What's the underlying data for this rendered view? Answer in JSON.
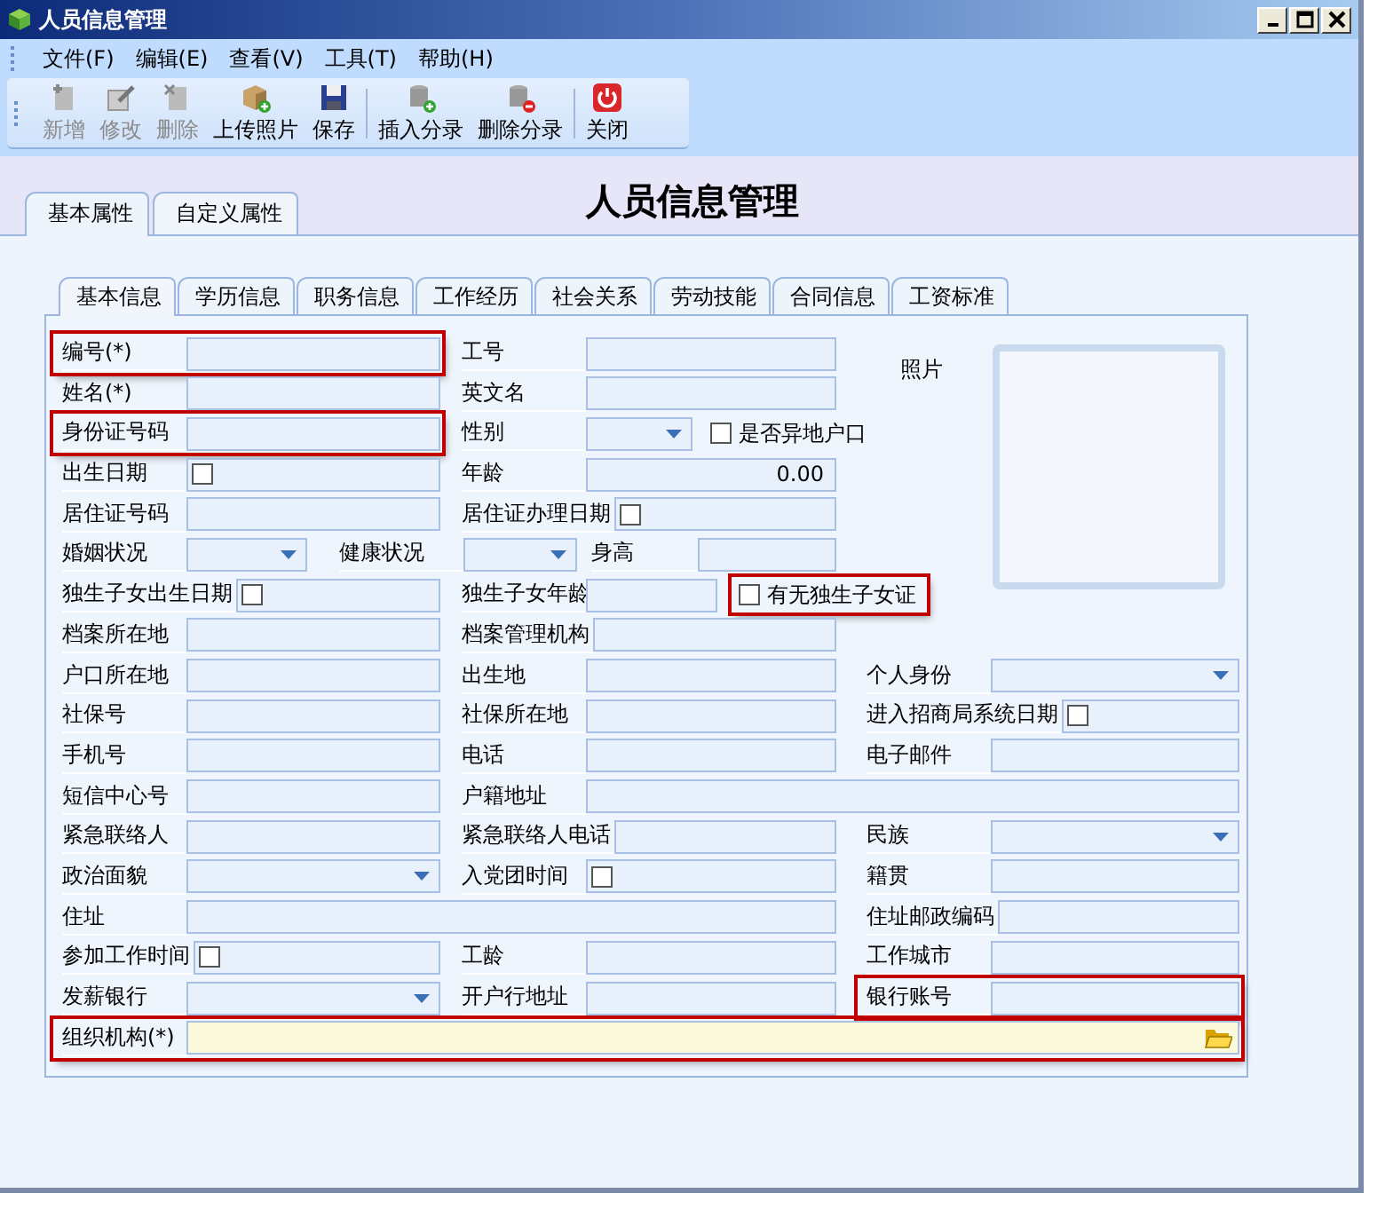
{
  "window": {
    "title": "人员信息管理"
  },
  "menu": [
    "文件(F)",
    "编辑(E)",
    "查看(V)",
    "工具(T)",
    "帮助(H)"
  ],
  "toolbar": [
    [
      {
        "label": "新增",
        "kind": "new",
        "disabled": true
      },
      {
        "label": "修改",
        "kind": "edit",
        "disabled": true
      },
      {
        "label": "删除",
        "kind": "delete",
        "disabled": true
      },
      {
        "label": "上传照片",
        "kind": "photo",
        "disabled": false
      },
      {
        "label": "保存",
        "kind": "save",
        "disabled": false
      }
    ],
    [
      {
        "label": "插入分录",
        "kind": "insert",
        "disabled": false
      },
      {
        "label": "删除分录",
        "kind": "remove",
        "disabled": false
      }
    ],
    [
      {
        "label": "关闭",
        "kind": "close",
        "disabled": false
      }
    ]
  ],
  "outer_tabs": [
    {
      "label": "基本属性",
      "selected": true
    },
    {
      "label": "自定义属性",
      "selected": false
    }
  ],
  "heading": "人员信息管理",
  "inner_tabs": [
    {
      "label": "基本信息",
      "selected": true
    },
    {
      "label": "学历信息",
      "selected": false
    },
    {
      "label": "职务信息",
      "selected": false
    },
    {
      "label": "工作经历",
      "selected": false
    },
    {
      "label": "社会关系",
      "selected": false
    },
    {
      "label": "劳动技能",
      "selected": false
    },
    {
      "label": "合同信息",
      "selected": false
    },
    {
      "label": "工资标准",
      "selected": false
    }
  ],
  "photo": {
    "label": "照片"
  },
  "form": {
    "rows": [
      {
        "kind": "std",
        "items": [
          {
            "label": "编号(*)",
            "kind": "text",
            "highlighted": true
          },
          {
            "label": "工号",
            "kind": "text"
          }
        ]
      },
      {
        "kind": "std",
        "items": [
          {
            "label": "姓名(*)",
            "kind": "text"
          },
          {
            "label": "英文名",
            "kind": "text"
          }
        ]
      },
      {
        "kind": "std",
        "items": [
          {
            "label": "身份证号码",
            "kind": "text",
            "highlighted": true
          },
          {
            "label": "性别",
            "kind": "combo",
            "check": {
              "label": "是否异地户口",
              "checked": false
            }
          }
        ]
      },
      {
        "kind": "std",
        "items": [
          {
            "label": "出生日期",
            "kind": "date",
            "checked": false
          },
          {
            "label": "年龄",
            "kind": "number",
            "value": "0.00"
          }
        ]
      },
      {
        "kind": "std",
        "items": [
          {
            "label": "居住证号码",
            "kind": "text"
          },
          {
            "label": "居住证办理日期",
            "kind": "date",
            "checked": false
          }
        ]
      },
      {
        "kind": "quad",
        "items": [
          {
            "label": "婚姻状况",
            "kind": "combo"
          },
          {
            "label": "健康状况",
            "kind": "combo"
          },
          {
            "label": "身高",
            "kind": "text"
          }
        ]
      },
      {
        "kind": "std",
        "items": [
          {
            "label": "独生子女出生日期",
            "kind": "date",
            "checked": false
          },
          {
            "label": "独生子女年龄",
            "kind": "text",
            "check": {
              "label": "有无独生子女证",
              "checked": false,
              "highlighted": true
            }
          }
        ]
      },
      {
        "kind": "std",
        "items": [
          {
            "label": "档案所在地",
            "kind": "text"
          },
          {
            "label": "档案管理机构",
            "kind": "text"
          }
        ]
      },
      {
        "kind": "std",
        "items": [
          {
            "label": "户口所在地",
            "kind": "text"
          },
          {
            "label": "出生地",
            "kind": "text"
          },
          {
            "label": "个人身份",
            "kind": "combo"
          }
        ]
      },
      {
        "kind": "std",
        "items": [
          {
            "label": "社保号",
            "kind": "text"
          },
          {
            "label": "社保所在地",
            "kind": "text"
          },
          {
            "label": "进入招商局系统日期",
            "kind": "date",
            "checked": false
          }
        ]
      },
      {
        "kind": "std",
        "items": [
          {
            "label": "手机号",
            "kind": "text"
          },
          {
            "label": "电话",
            "kind": "text"
          },
          {
            "label": "电子邮件",
            "kind": "text"
          }
        ]
      },
      {
        "kind": "wide-right",
        "items": [
          {
            "label": "短信中心号",
            "kind": "text"
          },
          {
            "label": "户籍地址",
            "kind": "text"
          }
        ]
      },
      {
        "kind": "std",
        "items": [
          {
            "label": "紧急联络人",
            "kind": "text"
          },
          {
            "label": "紧急联络人电话",
            "kind": "text"
          },
          {
            "label": "民族",
            "kind": "combo"
          }
        ]
      },
      {
        "kind": "std",
        "items": [
          {
            "label": "政治面貌",
            "kind": "combo"
          },
          {
            "label": "入党团时间",
            "kind": "date",
            "checked": false
          },
          {
            "label": "籍贯",
            "kind": "text"
          }
        ]
      },
      {
        "kind": "wide-left",
        "items": [
          {
            "label": "住址",
            "kind": "text"
          },
          {
            "label": "住址邮政编码",
            "kind": "text"
          }
        ]
      },
      {
        "kind": "std",
        "items": [
          {
            "label": "参加工作时间",
            "kind": "date",
            "checked": false
          },
          {
            "label": "工龄",
            "kind": "text"
          },
          {
            "label": "工作城市",
            "kind": "text"
          }
        ]
      },
      {
        "kind": "std",
        "items": [
          {
            "label": "发薪银行",
            "kind": "combo"
          },
          {
            "label": "开户行地址",
            "kind": "text"
          },
          {
            "label": "银行账号",
            "kind": "text",
            "highlighted": true
          }
        ]
      },
      {
        "kind": "full",
        "items": [
          {
            "label": "组织机构(*)",
            "kind": "lookup",
            "highlighted": true
          }
        ]
      }
    ]
  }
}
